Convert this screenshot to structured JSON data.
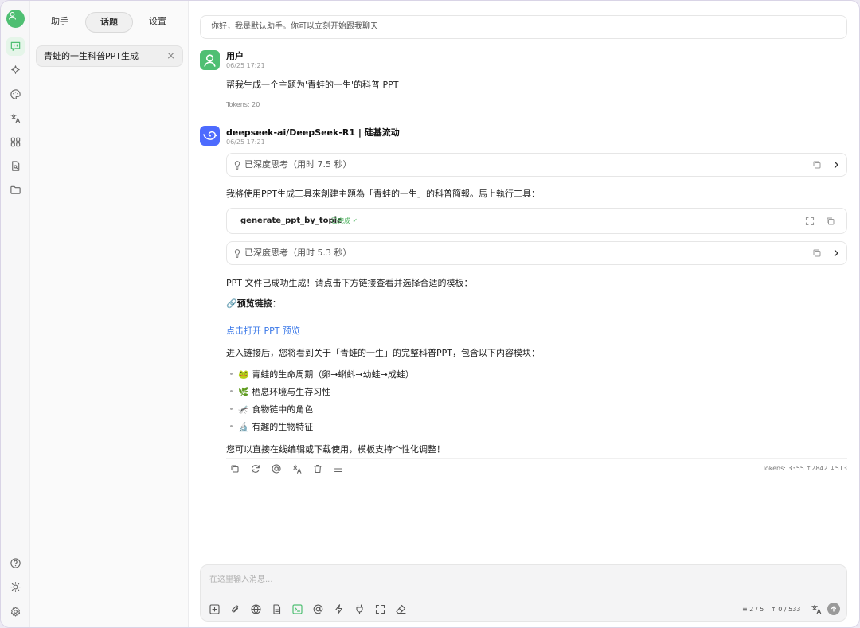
{
  "tabs": {
    "assistant": "助手",
    "topics": "话题",
    "settings": "设置"
  },
  "topic": {
    "title": "青蛙的一生科普PPT生成",
    "close": "×"
  },
  "assistant_hint": "你好，我是默认助手。你可以立刻开始跟我聊天",
  "user_msg": {
    "name": "用户",
    "time": "06/25 17:21",
    "text": "帮我生成一个主题为'青蛙的一生'的科普 PPT",
    "tokens": "Tokens: 20"
  },
  "ai_msg": {
    "name": "deepseek-ai/DeepSeek-R1 | 硅基流动",
    "time": "06/25 17:21",
    "think1": "已深度思考（用时 7.5 秒）",
    "intro": "我將使用PPT生成工具來創建主題為「青蛙的一生」的科普簡報。馬上執行工具：",
    "tool_name": "generate_ppt_by_topic",
    "tool_status": "已完成 ✓",
    "think2": "已深度思考（用时 5.3 秒）",
    "done": "PPT 文件已成功生成！请点击下方链接查看并选择合适的模板：",
    "preview_emoji": "🔗",
    "preview_label": "预览链接",
    "preview_colon": "：",
    "link": "点击打开 PPT 预览",
    "after_link": "进入链接后，您将看到关于「青蛙的一生」的完整科普PPT，包含以下内容模块：",
    "items": [
      {
        "emoji": "🐸",
        "text": "青蛙的生命周期（卵→蝌蚪→幼蛙→成蛙）"
      },
      {
        "emoji": "🌿",
        "text": "栖息环境与生存习性"
      },
      {
        "emoji": "🦟",
        "text": "食物链中的角色"
      },
      {
        "emoji": "🔬",
        "text": "有趣的生物特征"
      }
    ],
    "closing": "您可以直接在线编辑或下载使用，模板支持个性化调整！",
    "tokens": "Tokens: 3355 ↑2842 ↓513"
  },
  "input": {
    "placeholder": "在这里输入消息...",
    "context_count": "2 / 5",
    "token_count": "↑ 0 / 533"
  },
  "colors": {
    "accent": "#4fbf73",
    "link": "#3a78e8",
    "ai_avatar": "#4d6bfe",
    "done": "#52b563"
  }
}
